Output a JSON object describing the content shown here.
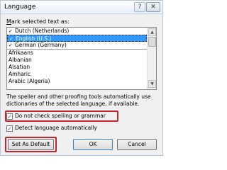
{
  "window": {
    "title": "Language",
    "help_glyph": "?",
    "close_glyph": "✕"
  },
  "mark_label": {
    "prefix": "",
    "underlined": "M",
    "rest": "ark selected text as:"
  },
  "languages": [
    {
      "label": "Dutch (Netherlands)",
      "spell_icon": true,
      "selected": false,
      "separator": false
    },
    {
      "label": "English (U.S.)",
      "spell_icon": true,
      "selected": true,
      "separator": false
    },
    {
      "label": "German (Germany)",
      "spell_icon": true,
      "selected": false,
      "separator": true
    },
    {
      "label": "Afrikaans",
      "spell_icon": false,
      "selected": false,
      "separator": false
    },
    {
      "label": "Albanian",
      "spell_icon": false,
      "selected": false,
      "separator": false
    },
    {
      "label": "Alsatian",
      "spell_icon": false,
      "selected": false,
      "separator": false
    },
    {
      "label": "Amharic",
      "spell_icon": false,
      "selected": false,
      "separator": false
    },
    {
      "label": "Arabic (Algeria)",
      "spell_icon": false,
      "selected": false,
      "separator": false
    }
  ],
  "info_text": "The speller and other proofing tools automatically use dictionaries of the selected language, if available.",
  "options": {
    "no_check": {
      "label": "Do not check spelling or grammar",
      "checked": true
    },
    "detect": {
      "label": "Detect language automatically",
      "checked": true
    }
  },
  "buttons": {
    "set_default": "Set As Default",
    "ok": "OK",
    "cancel": "Cancel"
  },
  "colors": {
    "selection": "#3399ff",
    "highlight": "#c0272d"
  }
}
